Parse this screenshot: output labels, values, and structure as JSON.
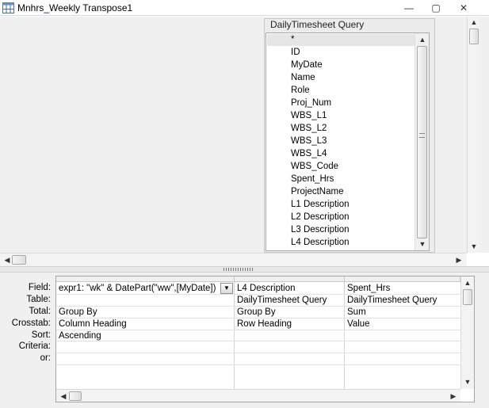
{
  "window": {
    "title": "Mnhrs_Weekly Transpose1",
    "minimize_glyph": "—",
    "restore_glyph": "▢",
    "close_glyph": "✕"
  },
  "table_box": {
    "title": "DailyTimesheet Query",
    "fields": [
      "*",
      "ID",
      "MyDate",
      "Name",
      "Role",
      "Proj_Num",
      "WBS_L1",
      "WBS_L2",
      "WBS_L3",
      "WBS_L4",
      "WBS_Code",
      "Spent_Hrs",
      "ProjectName",
      "L1 Description",
      "L2 Description",
      "L3 Description",
      "L4 Description"
    ]
  },
  "grid": {
    "row_labels": {
      "field": "Field:",
      "table": "Table:",
      "total": "Total:",
      "crosstab": "Crosstab:",
      "sort": "Sort:",
      "criteria": "Criteria:",
      "or": "or:"
    },
    "columns": [
      {
        "field": "expr1: \"wk\" & DatePart(\"ww\",[MyDate])",
        "table": "",
        "total": "Group By",
        "crosstab": "Column Heading",
        "sort": "Ascending"
      },
      {
        "field": "L4 Description",
        "table": "DailyTimesheet Query",
        "total": "Group By",
        "crosstab": "Row Heading",
        "sort": ""
      },
      {
        "field": "Spent_Hrs",
        "table": "DailyTimesheet Query",
        "total": "Sum",
        "crosstab": "Value",
        "sort": ""
      }
    ]
  },
  "icons": {
    "window_icon": "query-icon",
    "up": "▲",
    "down": "▼",
    "left": "◀",
    "right": "▶",
    "dropdown": "▼"
  }
}
